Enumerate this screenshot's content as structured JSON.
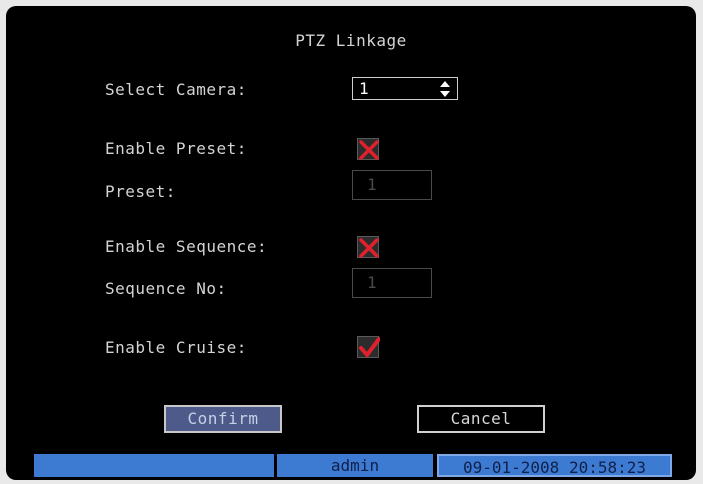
{
  "dialog": {
    "title": "PTZ Linkage",
    "select_camera_label": "Select Camera:",
    "select_camera_value": "1",
    "enable_preset_label": "Enable Preset:",
    "enable_preset_checked": false,
    "preset_label": "Preset:",
    "preset_value": "1",
    "enable_sequence_label": "Enable Sequence:",
    "enable_sequence_checked": false,
    "sequence_no_label": "Sequence No:",
    "sequence_no_value": "1",
    "enable_cruise_label": "Enable Cruise:",
    "enable_cruise_checked": true,
    "confirm_label": "Confirm",
    "cancel_label": "Cancel"
  },
  "statusbar": {
    "user": "admin",
    "datetime": "09-01-2008 20:58:23"
  },
  "colors": {
    "checkmark": "#e0202a",
    "status_blue": "#3d7bd2",
    "confirm_bg": "#4d5a8a"
  },
  "icons": {
    "unchecked": "red-x-icon",
    "checked": "red-checkmark-icon",
    "spinner": "up-down-arrows-icon"
  }
}
